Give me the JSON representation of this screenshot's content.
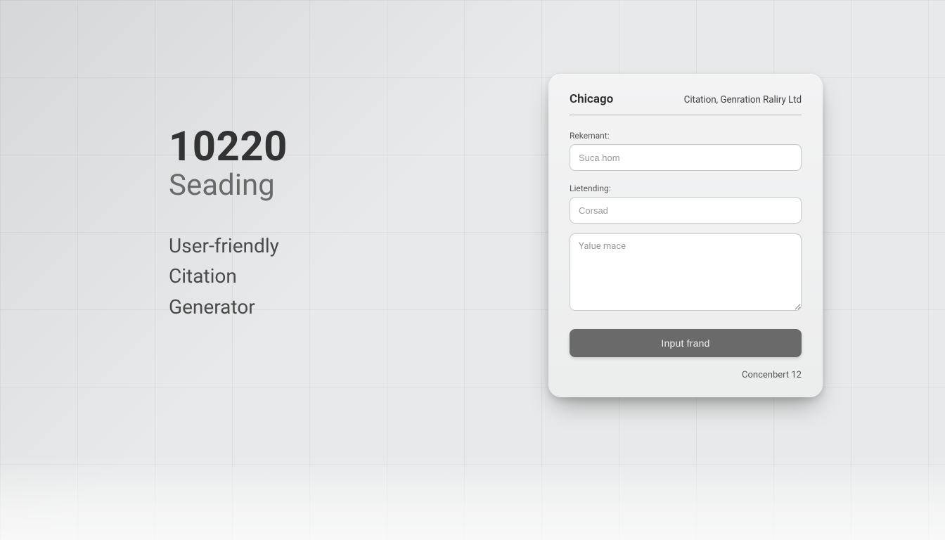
{
  "hero": {
    "big": "10220",
    "sub": "Seading",
    "tag1": "User-friendly",
    "tag2": "Citation",
    "tag3": "Generator"
  },
  "card": {
    "brand": "Chicago",
    "header_right": "Citation, Genration Raliry Ltd",
    "field1_label": "Rekemant:",
    "field1_placeholder": "Suca hom",
    "field2_label": "Lietending:",
    "field2_placeholder": "Corsad",
    "textarea_placeholder": "Yalue mace",
    "button_label": "Input frand",
    "footer": "Concenbert 12"
  }
}
